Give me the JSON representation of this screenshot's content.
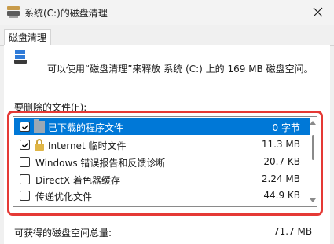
{
  "window": {
    "title": "系统(C:)的磁盘清理"
  },
  "tabs": [
    {
      "label": "磁盘清理"
    }
  ],
  "info": {
    "text": "可以使用“磁盘清理”来释放 系统 (C:) 上的 169 MB 磁盘空间。"
  },
  "files_label": "要删除的文件(F):",
  "files": [
    {
      "name": "已下载的程序文件",
      "size": "0 字节",
      "checked": true,
      "selected": true,
      "icon": "folder-icon"
    },
    {
      "name": "Internet 临时文件",
      "size": "11.3 MB",
      "checked": true,
      "selected": false,
      "icon": "lock-icon"
    },
    {
      "name": "Windows 错误报告和反馈诊断",
      "size": "20.7 KB",
      "checked": false,
      "selected": false,
      "icon": "none"
    },
    {
      "name": "DirectX 着色器缓存",
      "size": "2.24 MB",
      "checked": false,
      "selected": false,
      "icon": "none"
    },
    {
      "name": "传递优化文件",
      "size": "44.9 KB",
      "checked": false,
      "selected": false,
      "icon": "none"
    }
  ],
  "total": {
    "label": "可获得的磁盘空间总量:",
    "value": "71.7 MB"
  },
  "colors": {
    "selection": "#0078d7",
    "highlight_border": "#e53935"
  }
}
